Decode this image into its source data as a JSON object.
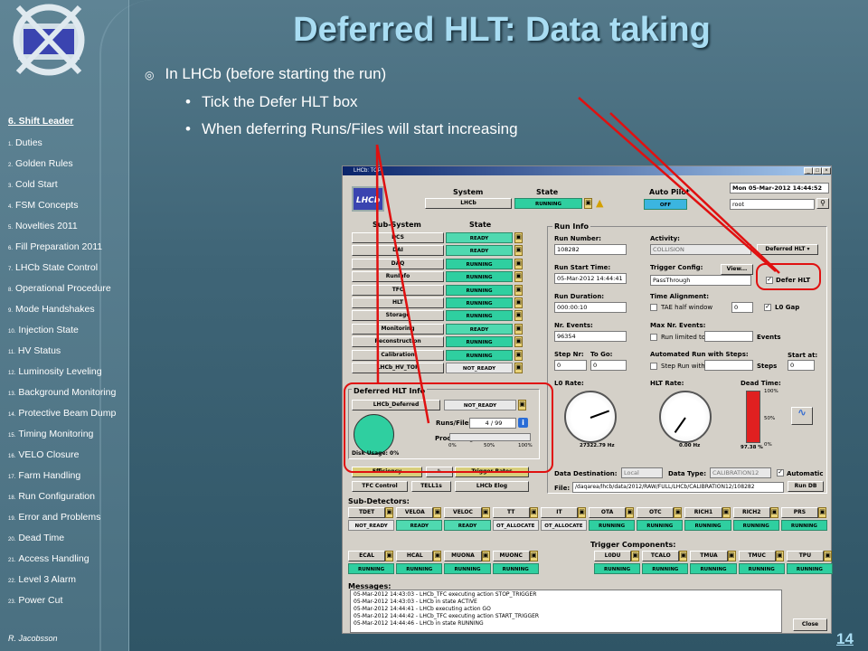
{
  "sidebar": {
    "section_title": "6. Shift Leader",
    "items": [
      {
        "n": "1.",
        "label": "Duties"
      },
      {
        "n": "2.",
        "label": "Golden Rules"
      },
      {
        "n": "3.",
        "label": "Cold Start"
      },
      {
        "n": "4.",
        "label": "FSM Concepts"
      },
      {
        "n": "5.",
        "label": "Novelties 2011"
      },
      {
        "n": "6.",
        "label": "Fill Preparation 2011"
      },
      {
        "n": "7.",
        "label": "LHCb State Control"
      },
      {
        "n": "8.",
        "label": "Operational Procedure"
      },
      {
        "n": "9.",
        "label": "Mode Handshakes"
      },
      {
        "n": "10.",
        "label": "Injection State"
      },
      {
        "n": "11.",
        "label": "HV Status"
      },
      {
        "n": "12.",
        "label": "Luminosity Leveling"
      },
      {
        "n": "13.",
        "label": "Background Monitoring"
      },
      {
        "n": "14.",
        "label": "Protective Beam Dump"
      },
      {
        "n": "15.",
        "label": "Timing Monitoring"
      },
      {
        "n": "16.",
        "label": "VELO Closure"
      },
      {
        "n": "17.",
        "label": "Farm Handling"
      },
      {
        "n": "18.",
        "label": "Run Configuration"
      },
      {
        "n": "19.",
        "label": "Error and Problems"
      },
      {
        "n": "20.",
        "label": "Dead Time"
      },
      {
        "n": "21.",
        "label": "Access Handling"
      },
      {
        "n": "22.",
        "label": "Level 3 Alarm"
      },
      {
        "n": "23.",
        "label": "Power Cut"
      }
    ],
    "author": "R. Jacobsson"
  },
  "slide": {
    "title": "Deferred HLT: Data taking",
    "bullet1": "In LHCb (before starting the run)",
    "bullet2": "Tick the Defer HLT box",
    "bullet3": "When deferring Runs/Files will start increasing",
    "page_number": "14"
  },
  "window": {
    "title": "LHCb: TOP",
    "logo": "LHCb",
    "system_label": "System",
    "state_label": "State",
    "system_name": "LHCb",
    "system_state": "RUNNING",
    "autopilot_label": "Auto Pilot",
    "autopilot_state": "OFF",
    "date": "Mon 05-Mar-2012   14:44:52",
    "user": "root",
    "subsystem_header": "Sub-System",
    "subsystem_state_header": "State",
    "subsystems": [
      {
        "name": "DCS",
        "state": "READY"
      },
      {
        "name": "DAI",
        "state": "READY"
      },
      {
        "name": "DAQ",
        "state": "RUNNING"
      },
      {
        "name": "RunInfo",
        "state": "RUNNING"
      },
      {
        "name": "TFC",
        "state": "RUNNING"
      },
      {
        "name": "HLT",
        "state": "RUNNING"
      },
      {
        "name": "Storage",
        "state": "RUNNING"
      },
      {
        "name": "Monitoring",
        "state": "READY"
      },
      {
        "name": "Reconstruction",
        "state": "RUNNING"
      },
      {
        "name": "Calibration",
        "state": "RUNNING"
      },
      {
        "name": "LHCb_HV_TOP",
        "state": "NOT_READY"
      }
    ],
    "deferred": {
      "title": "Deferred HLT Info",
      "name": "LHCb_Deferred",
      "state": "NOT_READY",
      "runs_files_label": "Runs/Files:",
      "runs_files": "4 / 99",
      "processing_label": "Processing:",
      "scale": [
        "0%",
        "50%",
        "100%"
      ],
      "disk_usage_label": "Disk Usage:",
      "disk_usage": "0%"
    },
    "buttons": {
      "efficiency": "Efficiency",
      "trigger_rates": "Trigger Rates",
      "tfc_control": "TFC Control",
      "tell1s": "TELL1s",
      "elog": "LHCb Elog",
      "run_db": "Run DB",
      "close": "Close",
      "view": "View..."
    },
    "run_info": {
      "title": "Run Info",
      "run_number_label": "Run Number:",
      "run_number": "108282",
      "activity_label": "Activity:",
      "activity": "COLLISION",
      "deferred_mode": "Deferred HLT",
      "start_time_label": "Run Start Time:",
      "start_time": "05-Mar-2012 14:44:41",
      "trigger_config_label": "Trigger Config:",
      "trigger_config": "PassThrough",
      "defer_hlt_label": "Defer HLT",
      "duration_label": "Run Duration:",
      "duration": "000:00:10",
      "time_alignment_label": "Time Alignment:",
      "tae_label": "TAE half window",
      "tae_value": "0",
      "l0gap_label": "L0 Gap",
      "nr_events_label": "Nr. Events:",
      "nr_events": "96354",
      "max_events_label": "Max Nr. Events:",
      "run_limited_label": "Run limited to",
      "events_label": "Events",
      "step_nr_label": "Step Nr:",
      "step_nr": "0",
      "to_go_label": "To Go:",
      "to_go": "0",
      "auto_run_label": "Automated Run with Steps:",
      "step_run_label": "Step Run with",
      "steps_label": "Steps",
      "start_at_label": "Start at:",
      "start_at": "0",
      "l0_rate_label": "L0 Rate:",
      "l0_rate": "27322.79 Hz",
      "hlt_rate_label": "HLT Rate:",
      "hlt_rate": "0.00 Hz",
      "dead_time_label": "Dead Time:",
      "dead_time": "97.38 %",
      "dead_scale": [
        "100%",
        "50%",
        "0%"
      ],
      "gauge_ticks": [
        "10",
        "10",
        "10",
        "10",
        "10",
        "10",
        "10"
      ],
      "data_dest_label": "Data Destination:",
      "data_dest": "Local",
      "data_type_label": "Data Type:",
      "data_type": "CALIBRATION12",
      "automatic_label": "Automatic",
      "file_label": "File:",
      "file": "/daqarea/lhcb/data/2012/RAW/FULL/LHCb/CALIBRATION12/108282"
    },
    "subdetectors_label": "Sub-Detectors:",
    "subdetectors": [
      {
        "name": "TDET",
        "state": "NOT_READY"
      },
      {
        "name": "VELOA",
        "state": "READY"
      },
      {
        "name": "VELOC",
        "state": "READY"
      },
      {
        "name": "TT",
        "state": "OT_ALLOCATE"
      },
      {
        "name": "IT",
        "state": "OT_ALLOCATE"
      },
      {
        "name": "OTA",
        "state": "RUNNING"
      },
      {
        "name": "OTC",
        "state": "RUNNING"
      },
      {
        "name": "RICH1",
        "state": "RUNNING"
      },
      {
        "name": "RICH2",
        "state": "RUNNING"
      },
      {
        "name": "PRS",
        "state": "RUNNING"
      }
    ],
    "subdetectors2": [
      {
        "name": "ECAL",
        "state": "RUNNING"
      },
      {
        "name": "HCAL",
        "state": "RUNNING"
      },
      {
        "name": "MUONA",
        "state": "RUNNING"
      },
      {
        "name": "MUONC",
        "state": "RUNNING"
      }
    ],
    "trigger_components_label": "Trigger Components:",
    "trigger_components": [
      {
        "name": "L0DU",
        "state": "RUNNING"
      },
      {
        "name": "TCALO",
        "state": "RUNNING"
      },
      {
        "name": "TMUA",
        "state": "RUNNING"
      },
      {
        "name": "TMUC",
        "state": "RUNNING"
      },
      {
        "name": "TPU",
        "state": "RUNNING"
      }
    ],
    "messages_label": "Messages:",
    "messages": [
      "05-Mar-2012 14:43:03 - LHCb_TFC executing action STOP_TRIGGER",
      "05-Mar-2012 14:43:03 - LHCb in state ACTIVE",
      "05-Mar-2012 14:44:41 - LHCb executing action GO",
      "05-Mar-2012 14:44:42 - LHCb_TFC executing action START_TRIGGER",
      "05-Mar-2012 14:44:46 - LHCb in state RUNNING"
    ]
  },
  "colors": {
    "title": "#a9ddf3",
    "running": "#2fcfa0",
    "annotation": "#e01010"
  }
}
